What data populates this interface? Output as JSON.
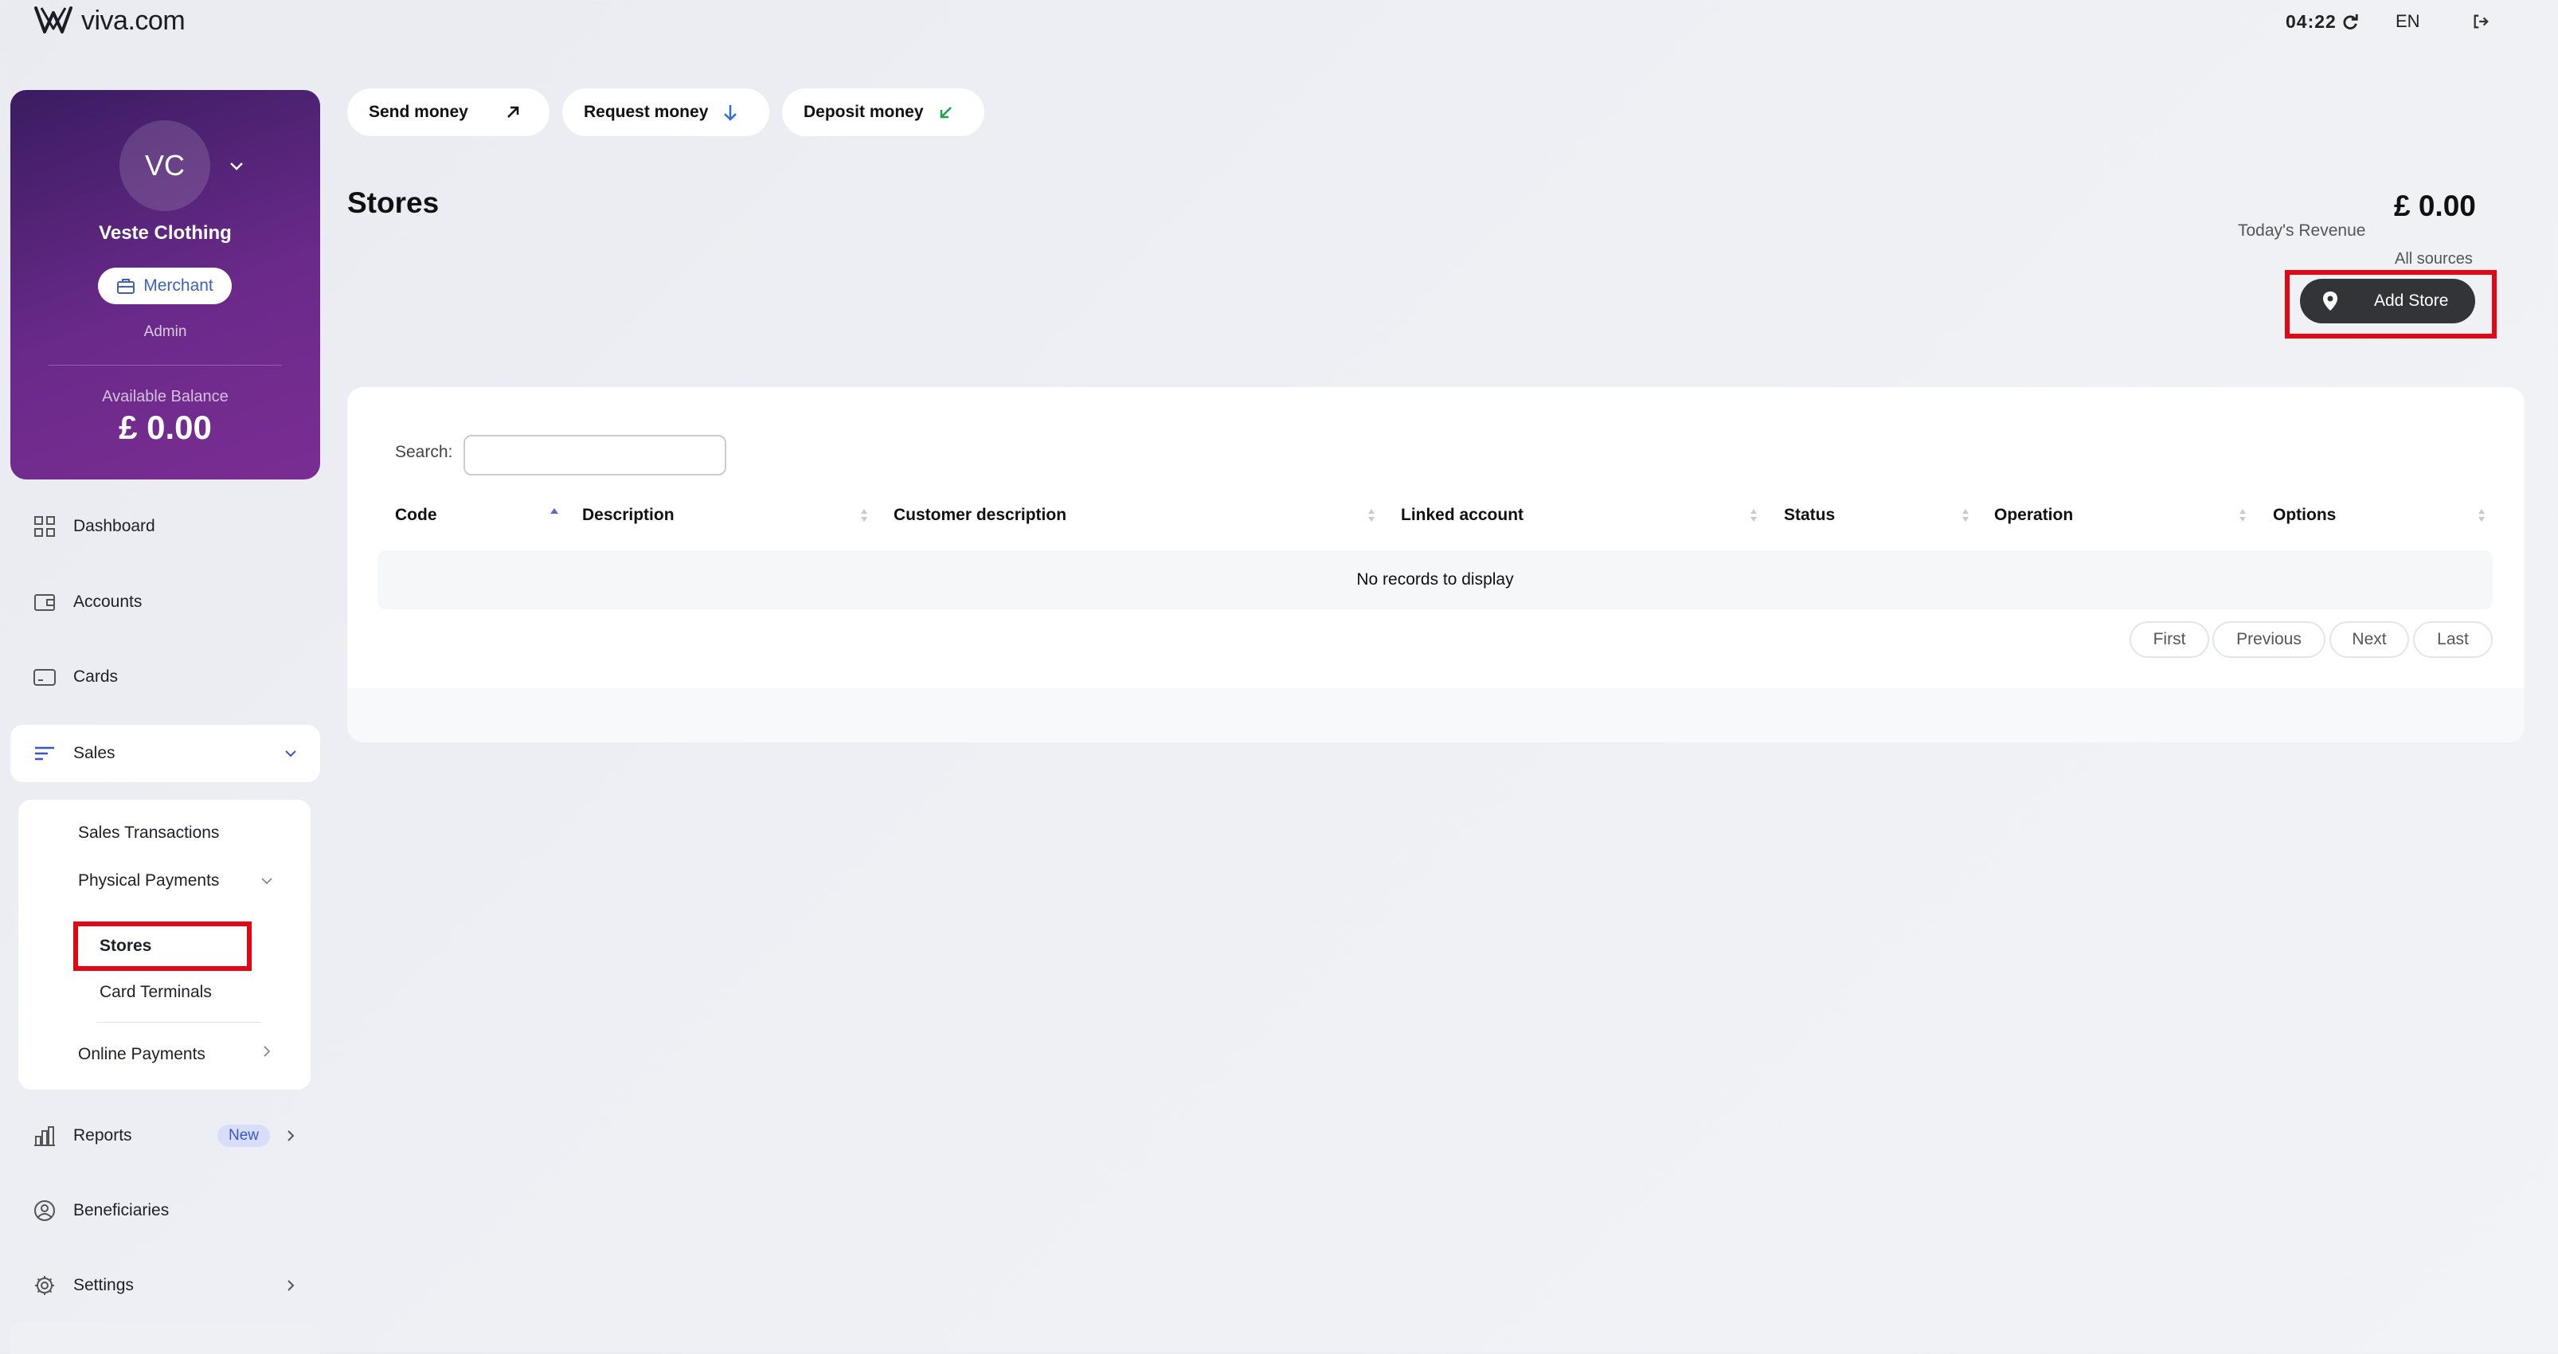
{
  "header": {
    "logo_text": "viva.com",
    "clock": "04:22",
    "language": "EN"
  },
  "profile": {
    "initials": "VC",
    "name": "Veste Clothing",
    "type_badge": "Merchant",
    "role": "Admin",
    "balance_label": "Available Balance",
    "balance_value": "£ 0.00"
  },
  "sidebar": {
    "items": [
      {
        "label": "Dashboard",
        "icon": "grid-icon"
      },
      {
        "label": "Accounts",
        "icon": "wallet-icon"
      },
      {
        "label": "Cards",
        "icon": "card-icon"
      },
      {
        "label": "Sales",
        "icon": "list-icon",
        "expanded": true
      },
      {
        "label": "Reports",
        "icon": "bar-chart-icon",
        "badge": "New"
      },
      {
        "label": "Beneficiaries",
        "icon": "user-circle-icon"
      },
      {
        "label": "Settings",
        "icon": "gear-icon"
      }
    ],
    "sales_sub": {
      "sales_transactions": "Sales Transactions",
      "physical_payments": "Physical Payments",
      "stores": "Stores",
      "card_terminals": "Card Terminals",
      "online_payments": "Online Payments"
    }
  },
  "actions": {
    "send": "Send money",
    "request": "Request money",
    "deposit": "Deposit money"
  },
  "page": {
    "title": "Stores",
    "revenue_value": "£ 0.00",
    "revenue_label": "Today's Revenue",
    "revenue_sources": "All sources",
    "add_store": "Add Store"
  },
  "table": {
    "search_label": "Search:",
    "search_value": "",
    "columns": [
      "Code",
      "Description",
      "Customer description",
      "Linked account",
      "Status",
      "Operation",
      "Options"
    ],
    "sorted_column": "Code",
    "sort_direction": "ascending",
    "rows": [],
    "empty_message": "No records to display",
    "pager": [
      "First",
      "Previous",
      "Next",
      "Last"
    ]
  },
  "colors": {
    "highlight_red": "#e30613",
    "profile_gradient_start": "#3a1c61",
    "profile_gradient_end": "#7a2d92",
    "add_store_bg": "#333438",
    "merchant_blue": "#3d63b8"
  }
}
